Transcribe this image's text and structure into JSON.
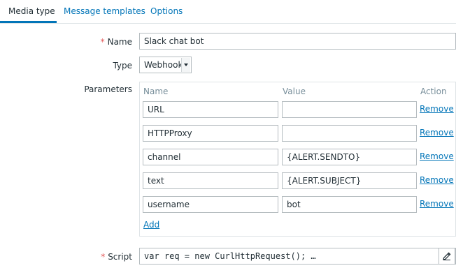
{
  "tabs": [
    {
      "label": "Media type",
      "active": true
    },
    {
      "label": "Message templates",
      "active": false
    },
    {
      "label": "Options",
      "active": false
    }
  ],
  "form": {
    "name_label": "Name",
    "name_value": "Slack chat bot",
    "type_label": "Type",
    "type_value": "Webhook",
    "parameters_label": "Parameters",
    "script_label": "Script",
    "script_value": "var req = new CurlHttpRequest(); …",
    "required_marker": "*"
  },
  "parameters": {
    "headers": {
      "name": "Name",
      "value": "Value",
      "action": "Action"
    },
    "rows": [
      {
        "name": "URL",
        "value": "",
        "action": "Remove"
      },
      {
        "name": "HTTPProxy",
        "value": "",
        "action": "Remove"
      },
      {
        "name": "channel",
        "value": "{ALERT.SENDTO}",
        "action": "Remove"
      },
      {
        "name": "text",
        "value": "{ALERT.SUBJECT}",
        "action": "Remove"
      },
      {
        "name": "username",
        "value": "bot",
        "action": "Remove"
      }
    ],
    "add_label": "Add"
  },
  "colors": {
    "link": "#0275b8",
    "required": "#e45959",
    "text": "#1f2c33",
    "border": "#b5bcc0"
  },
  "icons": {
    "select_arrow": "chevron-down-icon",
    "script_edit": "pencil-icon"
  }
}
